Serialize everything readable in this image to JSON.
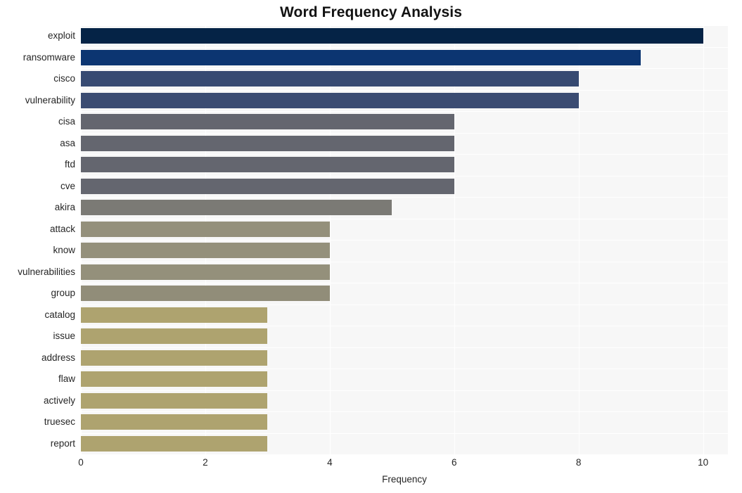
{
  "chart_data": {
    "type": "bar",
    "orientation": "horizontal",
    "title": "Word Frequency Analysis",
    "xlabel": "Frequency",
    "ylabel": "",
    "xlim": [
      0,
      10.4
    ],
    "xticks": [
      "0",
      "2",
      "4",
      "6",
      "8",
      "10"
    ],
    "xtick_values": [
      0,
      2,
      4,
      6,
      8,
      10
    ],
    "grid": true,
    "legend": "none",
    "plot_background": "#f7f7f7",
    "grid_color": "#ffffff",
    "categories": [
      "exploit",
      "ransomware",
      "cisco",
      "vulnerability",
      "cisa",
      "asa",
      "ftd",
      "cve",
      "akira",
      "attack",
      "know",
      "vulnerabilities",
      "group",
      "catalog",
      "issue",
      "address",
      "flaw",
      "actively",
      "truesec",
      "report"
    ],
    "values": [
      10,
      9,
      8,
      8,
      6,
      6,
      6,
      6,
      5,
      4,
      4,
      4,
      4,
      3,
      3,
      3,
      3,
      3,
      3,
      3
    ],
    "colors": [
      "#052346",
      "#0c3571",
      "#374a72",
      "#3b4c72",
      "#64666f",
      "#64666f",
      "#64666f",
      "#64666f",
      "#7b7a75",
      "#94907b",
      "#94907b",
      "#94907b",
      "#918d79",
      "#aea36f",
      "#aea36f",
      "#aea36f",
      "#aea36f",
      "#aea36f",
      "#aea36f",
      "#aea36f"
    ]
  }
}
